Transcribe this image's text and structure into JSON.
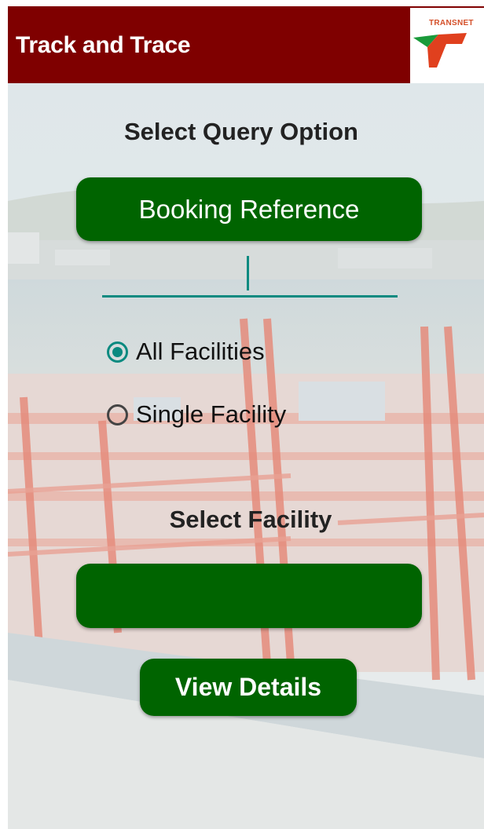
{
  "app_bar": {
    "title": "Track and Trace",
    "logo_text": "TRANSNET",
    "background_color": "#7f0000"
  },
  "logo": {
    "icon": "transnet-logo-icon"
  },
  "query": {
    "title": "Select Query Option",
    "option_button": "Booking Reference",
    "input_value": "",
    "input_placeholder": ""
  },
  "facility_scope": {
    "options": [
      {
        "label": "All Facilities",
        "checked": true
      },
      {
        "label": "Single Facility",
        "checked": false
      }
    ]
  },
  "facility": {
    "title": "Select Facility",
    "selected_value": ""
  },
  "actions": {
    "view_details": "View Details"
  },
  "colors": {
    "accent_green": "#006400",
    "teal": "#0a8a80"
  }
}
